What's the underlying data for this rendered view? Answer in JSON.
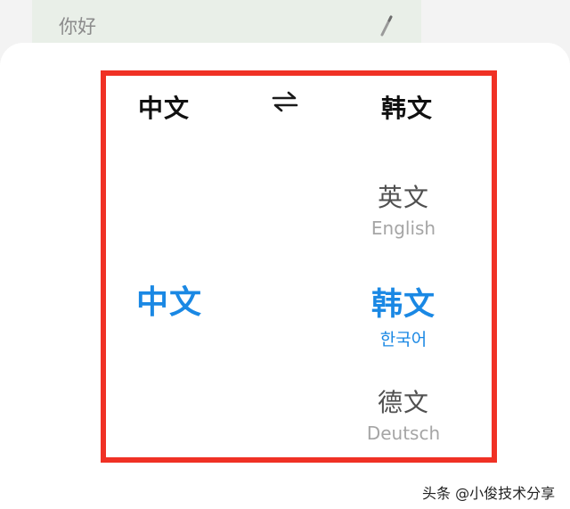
{
  "input": {
    "text": "你好",
    "edit_icon": "pencil-icon"
  },
  "picker": {
    "source_label": "中文",
    "target_label": "韩文",
    "swap_icon": "swap-arrows-icon",
    "source_selected": "中文",
    "options": [
      {
        "name": "英文",
        "native": "English"
      },
      {
        "name": "韩文",
        "native": "한국어",
        "selected": true
      },
      {
        "name": "德文",
        "native": "Deutsch"
      }
    ],
    "highlight_color": "#f03125",
    "accent_color": "#1a88e4"
  },
  "watermark": "头条 @小俊技术分享"
}
